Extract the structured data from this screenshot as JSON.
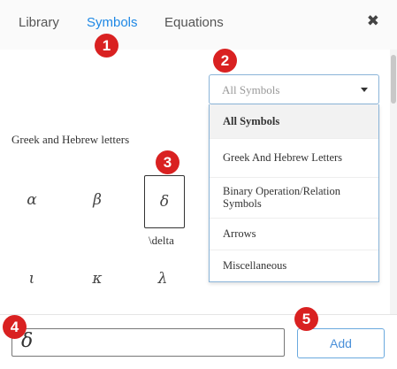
{
  "tabs": [
    {
      "label": "Library"
    },
    {
      "label": "Symbols"
    },
    {
      "label": "Equations"
    }
  ],
  "close_glyph": "✖",
  "badges": [
    "1",
    "2",
    "3",
    "4",
    "5"
  ],
  "symbols": {
    "group_label": "Greek and Hebrew letters",
    "row1": [
      "α",
      "β",
      "δ"
    ],
    "row2": [
      "ι",
      "κ",
      "λ"
    ],
    "selected_caption": "\\delta"
  },
  "category_select": {
    "value": "All Symbols",
    "options": [
      "All Symbols",
      "Greek And Hebrew Letters",
      "Binary Operation/Relation",
      "Symbols",
      "Arrows",
      "Miscellaneous"
    ]
  },
  "input": {
    "value": "δ"
  },
  "add_button": {
    "label": "Add"
  },
  "colors": {
    "accent": "#1e88e5",
    "badge": "#d92121"
  }
}
